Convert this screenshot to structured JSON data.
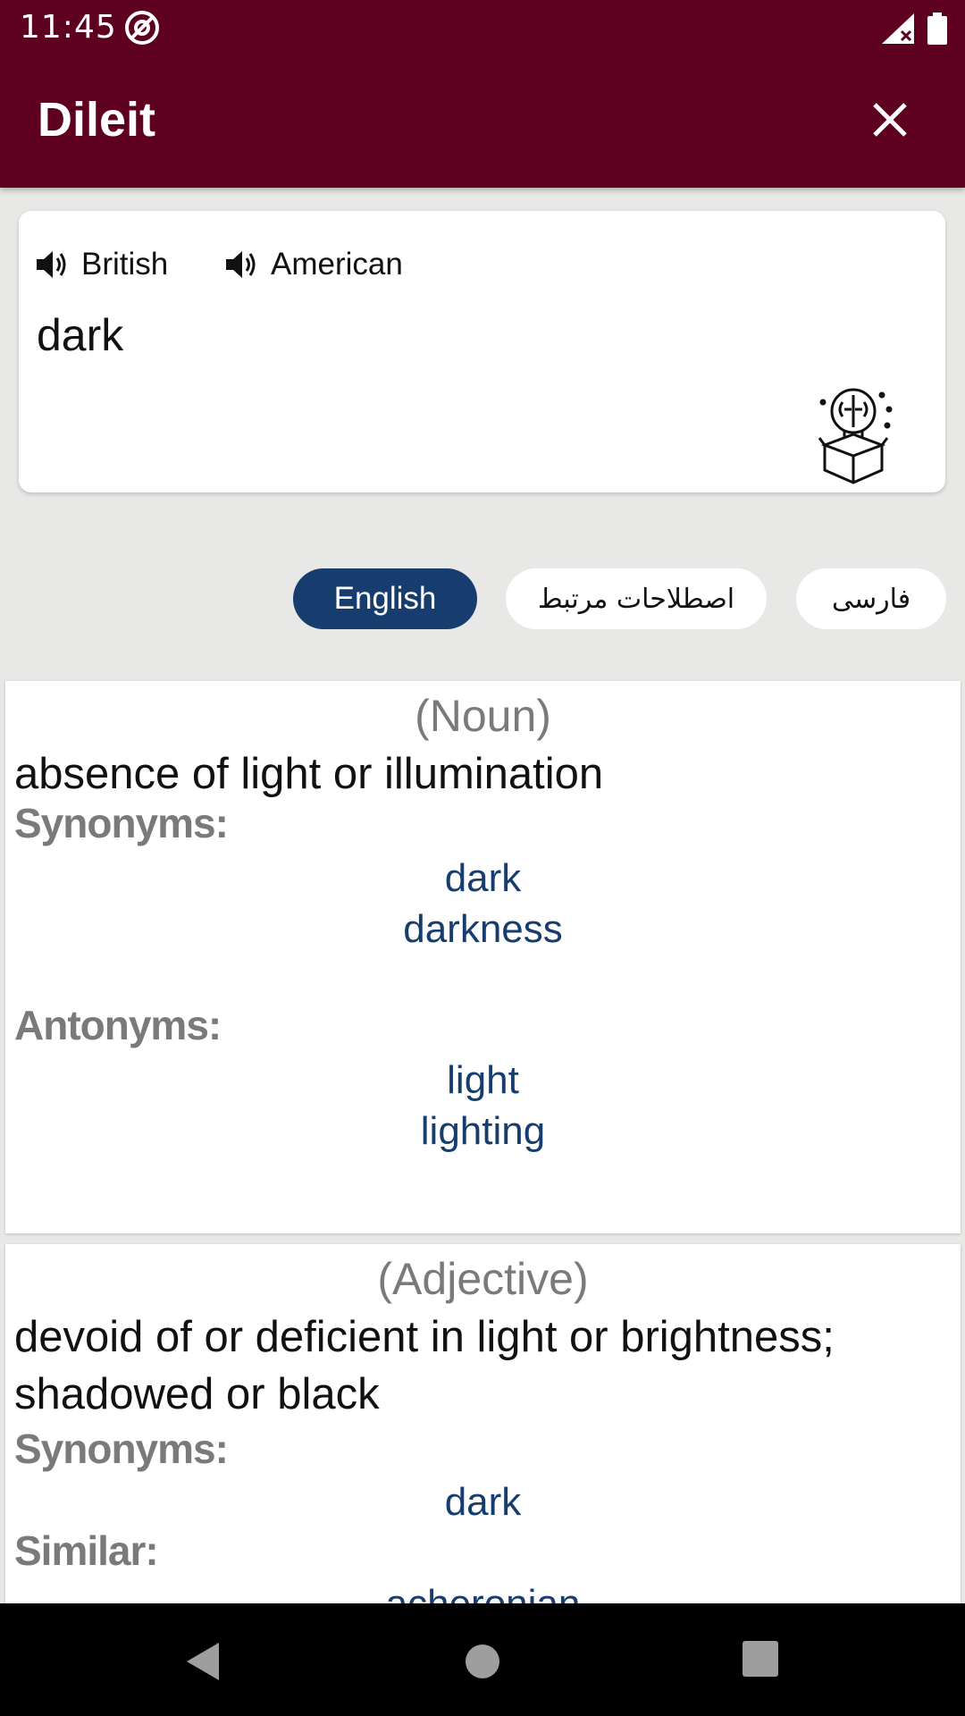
{
  "status_bar": {
    "time": "11:45"
  },
  "app_bar": {
    "title": "Dileit"
  },
  "word_card": {
    "pronunciations": [
      {
        "label": "British"
      },
      {
        "label": "American"
      }
    ],
    "word": "dark"
  },
  "tabs": [
    {
      "label": "English",
      "selected": true
    },
    {
      "label": "اصطلاحات مرتبط",
      "selected": false
    },
    {
      "label": "فارسی",
      "selected": false
    }
  ],
  "entries": [
    {
      "pos": "(Noun)",
      "definition": "absence of light or illumination",
      "synonyms_label": "Synonyms:",
      "synonyms": [
        "dark",
        "darkness"
      ],
      "antonyms_label": "Antonyms:",
      "antonyms": [
        "light",
        "lighting"
      ]
    },
    {
      "pos": "(Adjective)",
      "definition": "devoid of or deficient in light or brightness; shadowed or black",
      "synonyms_label": "Synonyms:",
      "synonyms": [
        "dark"
      ],
      "similar_label": "Similar:",
      "similar": [
        "acheronian"
      ]
    }
  ],
  "colors": {
    "app_bar": "#5e0020",
    "selected_chip": "#163d6e",
    "link": "#163d6e",
    "label_gray": "#7a7a7a"
  },
  "icons": [
    "at-sign-icon",
    "signal-icon",
    "battery-icon",
    "close-icon",
    "speaker-icon",
    "brain-bulb-icon",
    "back-icon",
    "home-icon",
    "recents-icon"
  ]
}
